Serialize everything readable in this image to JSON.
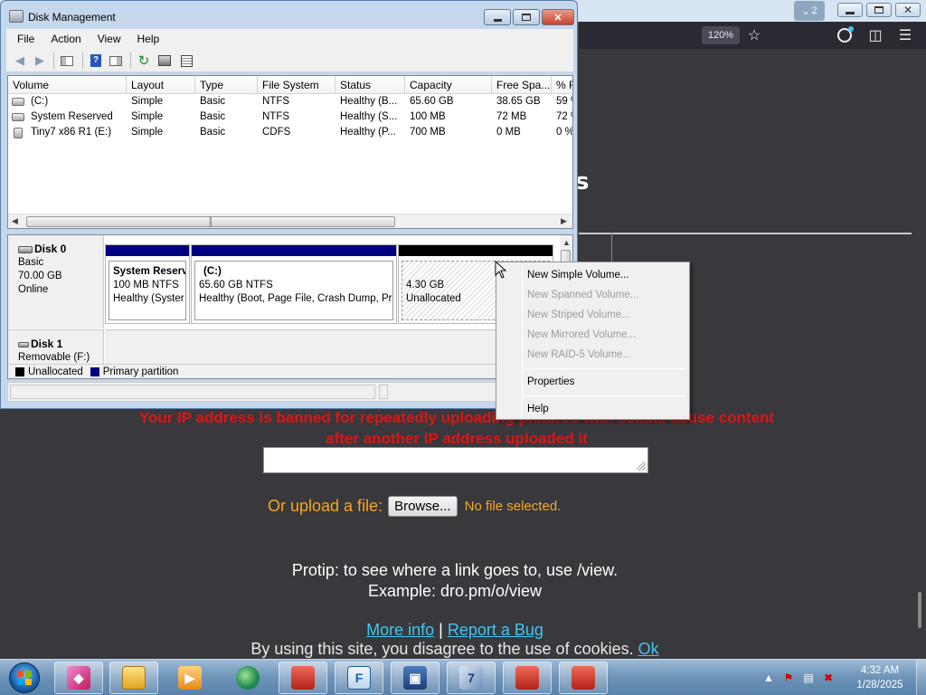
{
  "browser": {
    "tab_count": "2",
    "zoom": "120%",
    "heading_fragment": "s",
    "ban_message": "Your IP address is banned for repeatedly uploading pictures with sexual abuse content after another IP address uploaded it",
    "upload_label": "Or upload a file:",
    "browse_label": "Browse...",
    "no_file_text": "No file selected.",
    "protip_line1": "Protip: to see where a link goes to, use /view.",
    "protip_line2": "Example: dro.pm/o/view",
    "more_info": "More info",
    "separator": "|",
    "report_bug": "Report a Bug",
    "cookie_text": "By using this site, you disagree to the use of cookies.",
    "cookie_ok": "Ok"
  },
  "dm": {
    "title": "Disk Management",
    "menu": [
      "File",
      "Action",
      "View",
      "Help"
    ],
    "columns": [
      "Volume",
      "Layout",
      "Type",
      "File System",
      "Status",
      "Capacity",
      "Free Spa...",
      "% F"
    ],
    "volumes": [
      [
        "(C:)",
        "Simple",
        "Basic",
        "NTFS",
        "Healthy (B...",
        "65.60 GB",
        "38.65 GB",
        "59 %"
      ],
      [
        "System Reserved",
        "Simple",
        "Basic",
        "NTFS",
        "Healthy (S...",
        "100 MB",
        "72 MB",
        "72 %"
      ],
      [
        "Tiny7 x86 R1 (E:)",
        "Simple",
        "Basic",
        "CDFS",
        "Healthy (P...",
        "700 MB",
        "0 MB",
        "0 %"
      ]
    ],
    "disk0": {
      "name": "Disk 0",
      "type": "Basic",
      "size": "70.00 GB",
      "state": "Online",
      "partitions": [
        {
          "title": "System Reserv",
          "line1": "100 MB NTFS",
          "line2": "Healthy (Syster"
        },
        {
          "title": "(C:)",
          "line1": "65.60 GB NTFS",
          "line2": "Healthy (Boot, Page File, Crash Dump, Pr"
        },
        {
          "title": "",
          "line1": "4.30 GB",
          "line2": "Unallocated"
        }
      ]
    },
    "disk1": {
      "name": "Disk 1",
      "type": "Removable (F:)"
    },
    "legend": [
      "Unallocated",
      "Primary partition"
    ],
    "colors": {
      "primary": "#000080",
      "unallocated": "#000000"
    }
  },
  "context_menu": {
    "items": [
      {
        "label": "New Simple Volume...",
        "enabled": true
      },
      {
        "label": "New Spanned Volume...",
        "enabled": false
      },
      {
        "label": "New Striped Volume...",
        "enabled": false
      },
      {
        "label": "New Mirrored Volume...",
        "enabled": false
      },
      {
        "label": "New RAID-5 Volume...",
        "enabled": false
      },
      {
        "label": "Properties",
        "enabled": true
      },
      {
        "label": "Help",
        "enabled": true
      }
    ]
  },
  "taskbar": {
    "time": "4:32 AM",
    "date": "1/28/2025"
  }
}
